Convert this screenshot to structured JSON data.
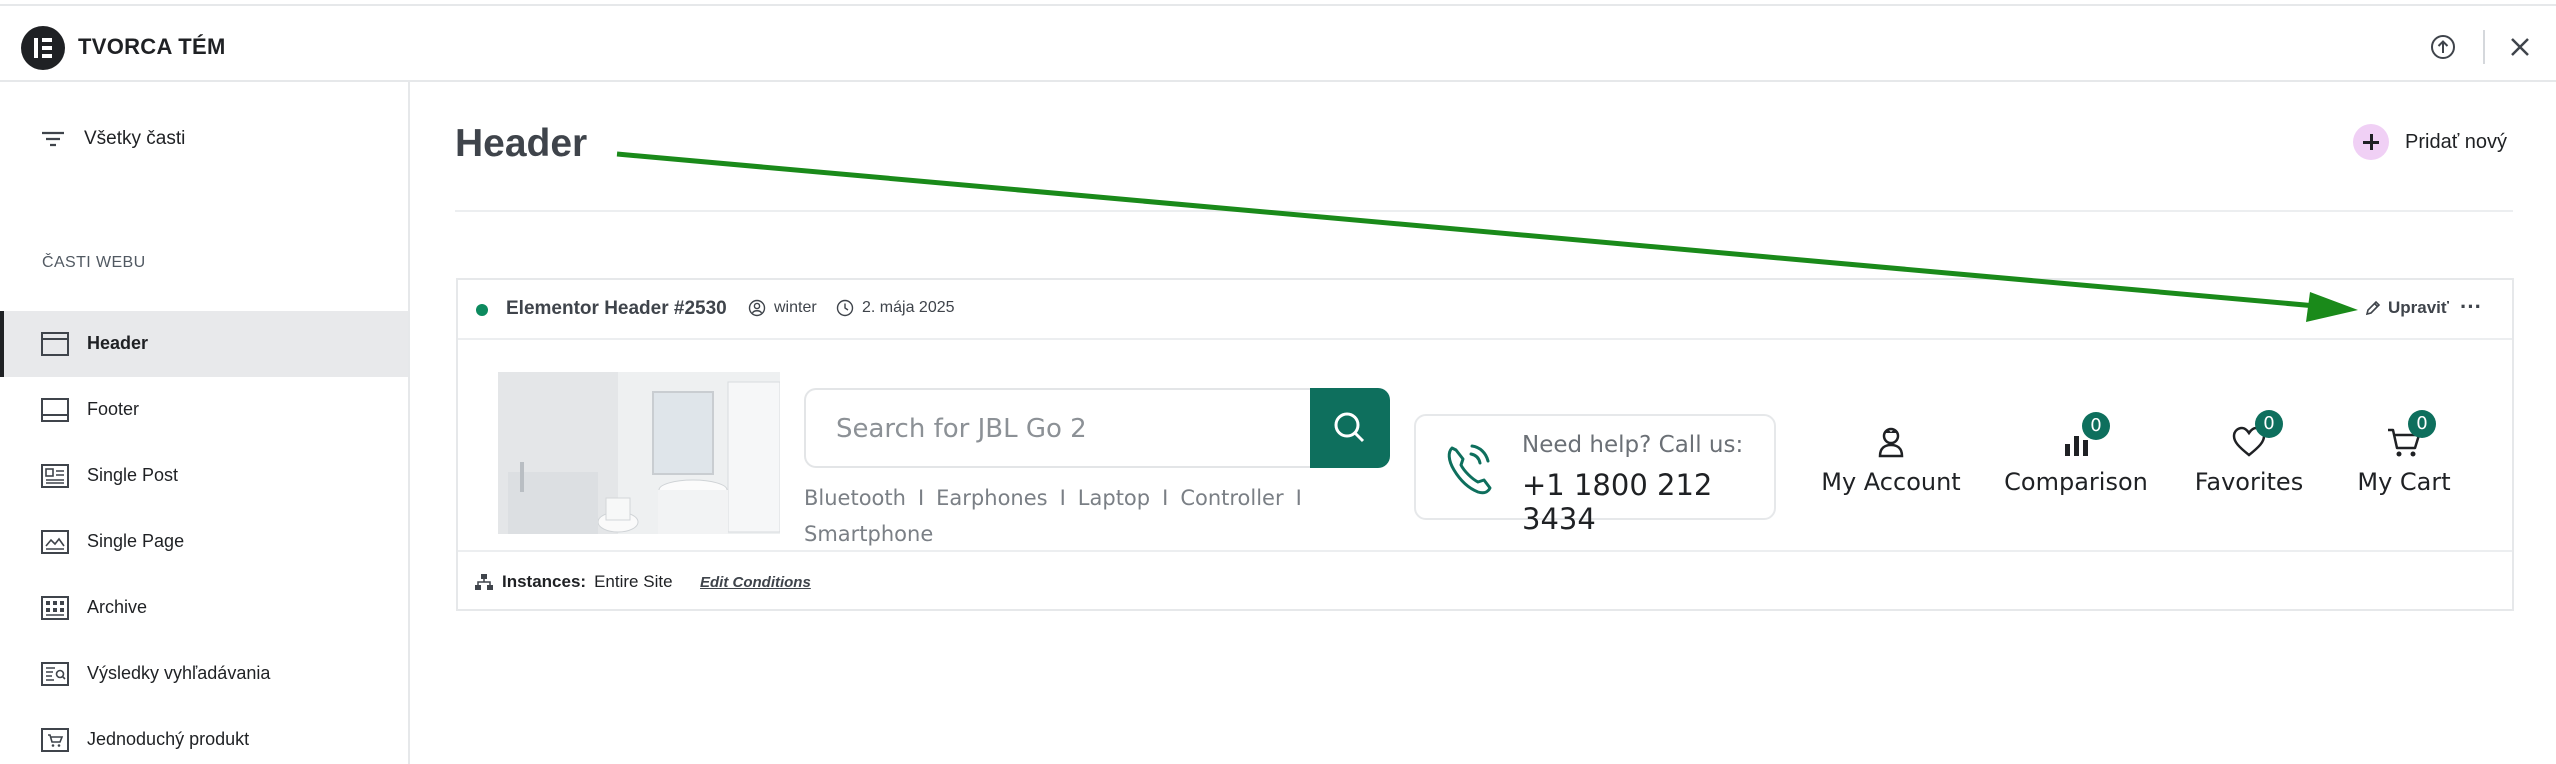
{
  "topbar": {
    "app_title": "TVORCA TÉM",
    "help_icon": "upload-circle-icon",
    "close_icon": "close-icon"
  },
  "sidebar": {
    "all_parts_label": "Všetky časti",
    "section_label": "ČASTI WEBU",
    "items": [
      {
        "label": "Header",
        "icon": "header-layout-icon",
        "active": true
      },
      {
        "label": "Footer",
        "icon": "footer-layout-icon",
        "active": false
      },
      {
        "label": "Single Post",
        "icon": "single-post-icon",
        "active": false
      },
      {
        "label": "Single Page",
        "icon": "single-page-icon",
        "active": false
      },
      {
        "label": "Archive",
        "icon": "archive-grid-icon",
        "active": false
      },
      {
        "label": "Výsledky vyhľadávania",
        "icon": "search-results-icon",
        "active": false
      },
      {
        "label": "Jednoduchý produkt",
        "icon": "product-icon",
        "active": false
      }
    ]
  },
  "main": {
    "title": "Header",
    "add_new_label": "Pridať nový"
  },
  "card": {
    "title": "Elementor Header #2530",
    "author": "winter",
    "date": "2. mája 2025",
    "edit_label": "Upraviť",
    "more_label": "···",
    "status_color": "#0c8a5e",
    "preview": {
      "search_placeholder": "Search for JBL Go 2",
      "tags": [
        "Bluetooth",
        "Earphones",
        "Laptop",
        "Controller",
        "Smartphone"
      ],
      "tag_separator": "I",
      "help_line1": "Need help? Call us:",
      "help_line2": "+1 1800 212 3434",
      "account_label": "My Account",
      "comparison_label": "Comparison",
      "comparison_count": "0",
      "favorites_label": "Favorites",
      "favorites_count": "0",
      "cart_label": "My Cart",
      "cart_count": "0",
      "accent_color": "#0e6f5d"
    },
    "instances_label": "Instances:",
    "instances_value": "Entire Site",
    "edit_conditions_label": "Edit Conditions"
  },
  "annotation": {
    "arrow_color": "#1a8a1a"
  }
}
